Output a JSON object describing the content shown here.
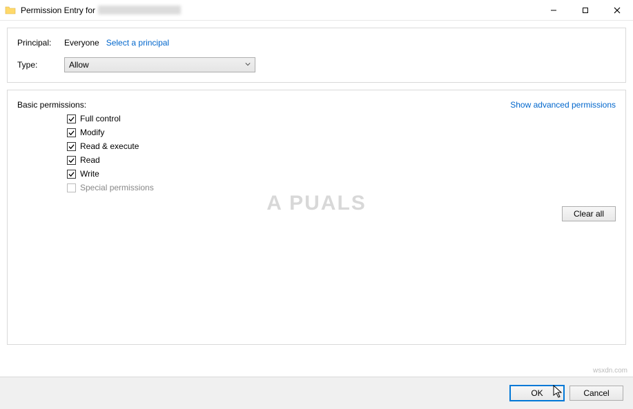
{
  "window": {
    "title_prefix": "Permission Entry for"
  },
  "principal": {
    "label": "Principal:",
    "value": "Everyone",
    "select_link": "Select a principal"
  },
  "type": {
    "label": "Type:",
    "selected": "Allow"
  },
  "basic": {
    "header": "Basic permissions:",
    "show_advanced": "Show advanced permissions",
    "items": [
      {
        "label": "Full control",
        "checked": true,
        "enabled": true
      },
      {
        "label": "Modify",
        "checked": true,
        "enabled": true
      },
      {
        "label": "Read & execute",
        "checked": true,
        "enabled": true
      },
      {
        "label": "Read",
        "checked": true,
        "enabled": true
      },
      {
        "label": "Write",
        "checked": true,
        "enabled": true
      },
      {
        "label": "Special permissions",
        "checked": false,
        "enabled": false
      }
    ],
    "clear_all": "Clear all"
  },
  "footer": {
    "ok": "OK",
    "cancel": "Cancel"
  },
  "watermark": {
    "center": "A   PUALS",
    "attr": "wsxdn.com"
  }
}
